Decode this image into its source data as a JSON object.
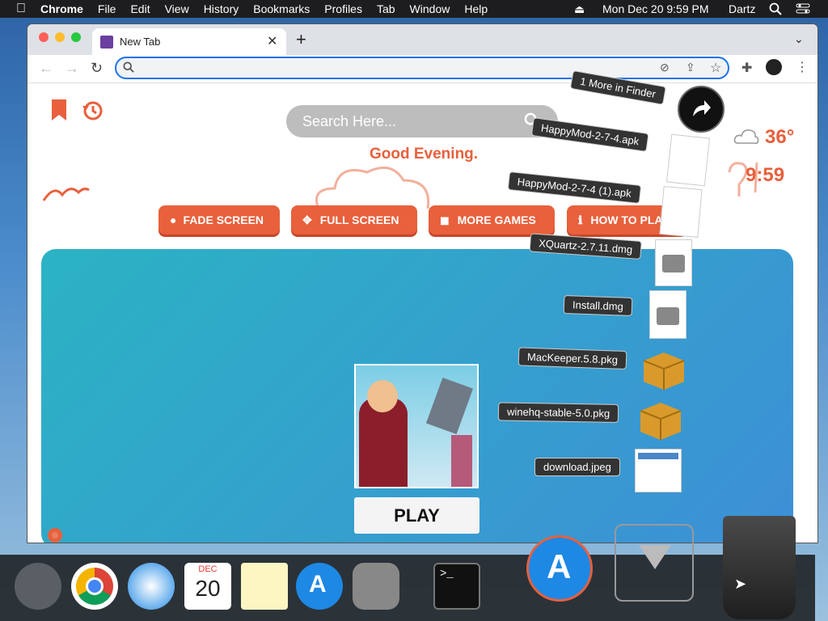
{
  "menubar": {
    "app": "Chrome",
    "items": [
      "File",
      "Edit",
      "View",
      "History",
      "Bookmarks",
      "Profiles",
      "Tab",
      "Window",
      "Help"
    ],
    "datetime": "Mon Dec 20  9:59 PM",
    "user": "Dartz"
  },
  "browser": {
    "tab_title": "New Tab",
    "new_tab": "+",
    "omnibox_value": ""
  },
  "page": {
    "search_placeholder": "Search Here...",
    "greeting": "Good Evening.",
    "temperature": "36°",
    "time": "9:59",
    "buttons": [
      "FADE SCREEN",
      "FULL SCREEN",
      "MORE GAMES",
      "HOW TO PLAY"
    ],
    "play_label": "PLAY"
  },
  "stack": {
    "more": "1 More in Finder",
    "files": [
      "HappyMod-2-7-4.apk",
      "HappyMod-2-7-4 (1).apk",
      "XQuartz-2.7.11.dmg",
      "Install.dmg",
      "MacKeeper.5.8.pkg",
      "winehq-stable-5.0.pkg",
      "download.jpeg"
    ]
  },
  "dock": {
    "calendar_month": "DEC",
    "calendar_day": "20",
    "terminal_prompt": ">_"
  },
  "colors": {
    "accent_orange": "#e8603c",
    "omnibox_focus": "#1a73e8",
    "game_bg": "#2bb3c4"
  }
}
